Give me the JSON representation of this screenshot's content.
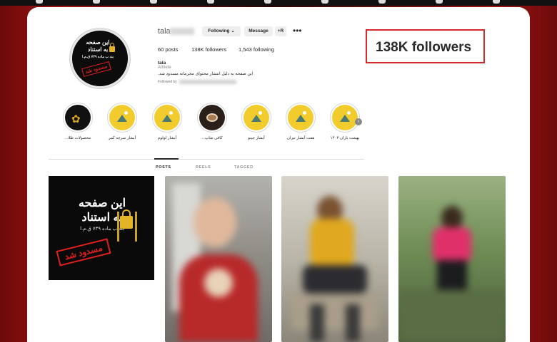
{
  "profile": {
    "username": "tala",
    "buttons": {
      "follow": "Following ⌄",
      "message": "Message",
      "add_user": "+R"
    },
    "more": "•••",
    "stats": {
      "posts": "60 posts",
      "followers": "138K followers",
      "following": "1,543 following"
    },
    "name": "tala",
    "category": "Athlete",
    "bio": "این صفحه به دلیل انتشار محتوای مجرمانه مسدود شد.",
    "followed_by": "Followed by",
    "avatar": {
      "line1": "این صفحه",
      "line2": "به استناد",
      "line3": "بند ب ماده ۷۳۹ ق.م.ا",
      "stamp": "مسدود شد"
    }
  },
  "highlight": {
    "text": "138K followers"
  },
  "stories": [
    {
      "label": "محصولات طلا...",
      "icon": "lotus-logo-icon",
      "style": "dark"
    },
    {
      "label": "آبشار سرچه کمر",
      "icon": "mountain-icon",
      "style": "yellow"
    },
    {
      "label": "آبشار لولوم",
      "icon": "mountain-icon",
      "style": "yellow"
    },
    {
      "label": "کافی شاپ...",
      "icon": "coffee-cup-icon",
      "style": "coffee"
    },
    {
      "label": "آبشار چینو",
      "icon": "mountain-icon",
      "style": "yellow"
    },
    {
      "label": "هفت آبشار تیران",
      "icon": "mountain-icon",
      "style": "yellow"
    },
    {
      "label": "بهشت باران ۱۴۰۳",
      "icon": "mountain-icon",
      "style": "yellow"
    }
  ],
  "tabs": {
    "posts": "POSTS",
    "reels": "REELS",
    "tagged": "TAGGED"
  },
  "post_blocked": {
    "line1": "این صفحه",
    "line2": "به استناد",
    "line3": "بند ب ماده ۷۳۹ ق.م.ا",
    "stamp": "مسدود شد"
  },
  "colors": {
    "accent_red": "#d42a2a",
    "story_yellow": "#f2cc2d",
    "lock_gold": "#e3b526"
  }
}
